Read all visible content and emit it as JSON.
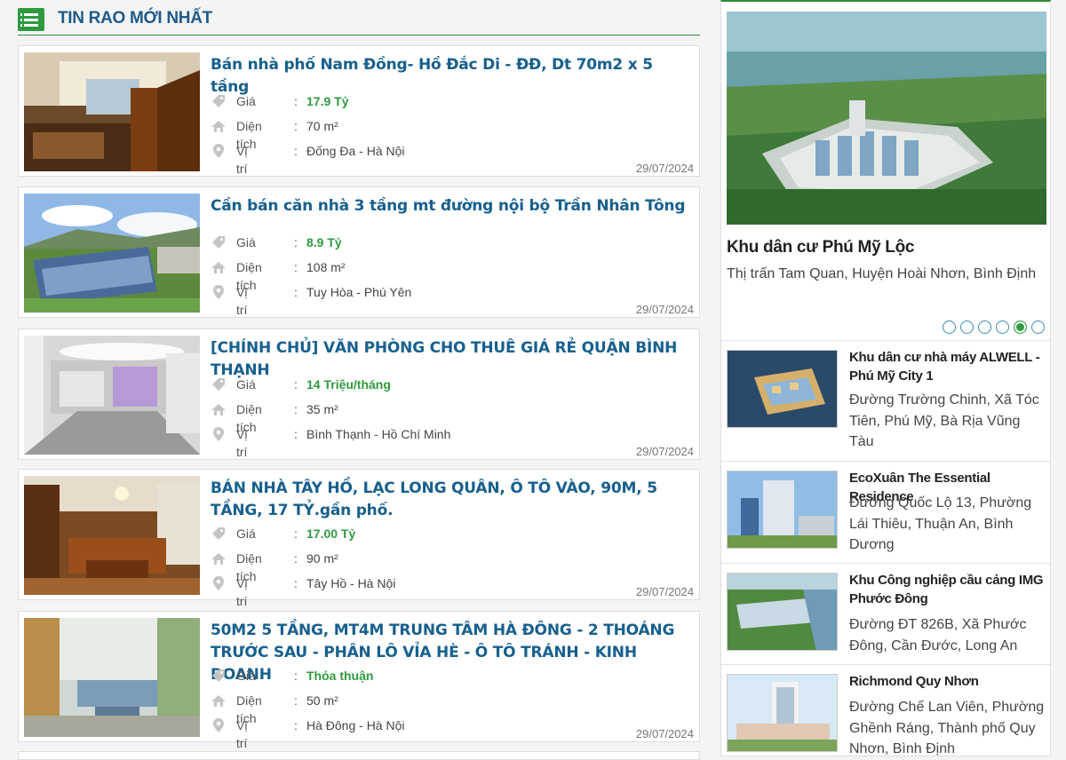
{
  "section": {
    "title": "TIN RAO MỚI NHẤT"
  },
  "labels": {
    "price": "Giá",
    "area": "Diện tích",
    "location": "Vị trí",
    "colon": ":"
  },
  "listings": [
    {
      "title": "Bán nhà phố Nam Đồng- Hồ Đắc Di - ĐĐ, Dt 70m2 x 5 tầng",
      "price": "17.9 Tỷ",
      "area": "70 m²",
      "location": "Đống Đa - Hà Nội",
      "date": "29/07/2024"
    },
    {
      "title": "Cần bán căn nhà 3 tầng mt đường nội bộ Trần Nhân Tông",
      "price": "8.9 Tỷ",
      "area": "108 m²",
      "location": "Tuy Hòa - Phú Yên",
      "date": "29/07/2024"
    },
    {
      "title": "[CHÍNH CHỦ] VĂN PHÒNG CHO THUÊ GIÁ RẺ QUẬN BÌNH THẠNH",
      "price": "14 Triệu/tháng",
      "area": "35 m²",
      "location": "Bình Thạnh - Hồ Chí Minh",
      "date": "29/07/2024"
    },
    {
      "title": "BÁN NHÀ TÂY HỒ, LẠC LONG QUÂN, Ô TÔ VÀO, 90M, 5 TẦNG, 17 TỶ.gần phố.",
      "price": "17.00 Tỷ",
      "area": "90 m²",
      "location": "Tây Hồ - Hà Nội",
      "date": "29/07/2024"
    },
    {
      "title": "50M2 5 TẦNG, MT4M TRUNG TÂM HÀ ĐÔNG - 2 THOÁNG TRƯỚC SAU - PHÂN LÔ VỈA HÈ - Ô TÔ TRÁNH - KINH DOANH",
      "price": "Thỏa thuận",
      "area": "50 m²",
      "location": "Hà Đông - Hà Nội",
      "date": "29/07/2024"
    }
  ],
  "featured": {
    "title": "Khu dân cư Phú Mỹ Lộc",
    "address": "Thị trấn Tam Quan, Huyện Hoài Nhơn, Bình Định",
    "slide_count": 6,
    "active_slide": 5
  },
  "projects": [
    {
      "name": "Khu dân cư nhà máy ALWELL - Phú Mỹ City 1",
      "address": "Đường Trường Chinh, Xã Tóc Tiên, Phú Mỹ, Bà Rịa Vũng Tàu"
    },
    {
      "name": "EcoXuân The Essential Residence",
      "address": "Đường Quốc Lộ 13, Phường Lái Thiêu, Thuận An, Bình Dương"
    },
    {
      "name": "Khu Công nghiệp cầu cảng IMG Phước Đông",
      "address": "Đường ĐT 826B, Xã Phước Đông, Cần Đước, Long An"
    },
    {
      "name": "Richmond Quy Nhơn",
      "address": "Đường Chế Lan Viên, Phường Ghềnh Ráng, Thành phố Quy Nhơn, Bình Định"
    }
  ],
  "colors": {
    "accent_green": "#2e9a3f",
    "title_blue": "#17608e",
    "header_blue": "#1e5a8a"
  }
}
